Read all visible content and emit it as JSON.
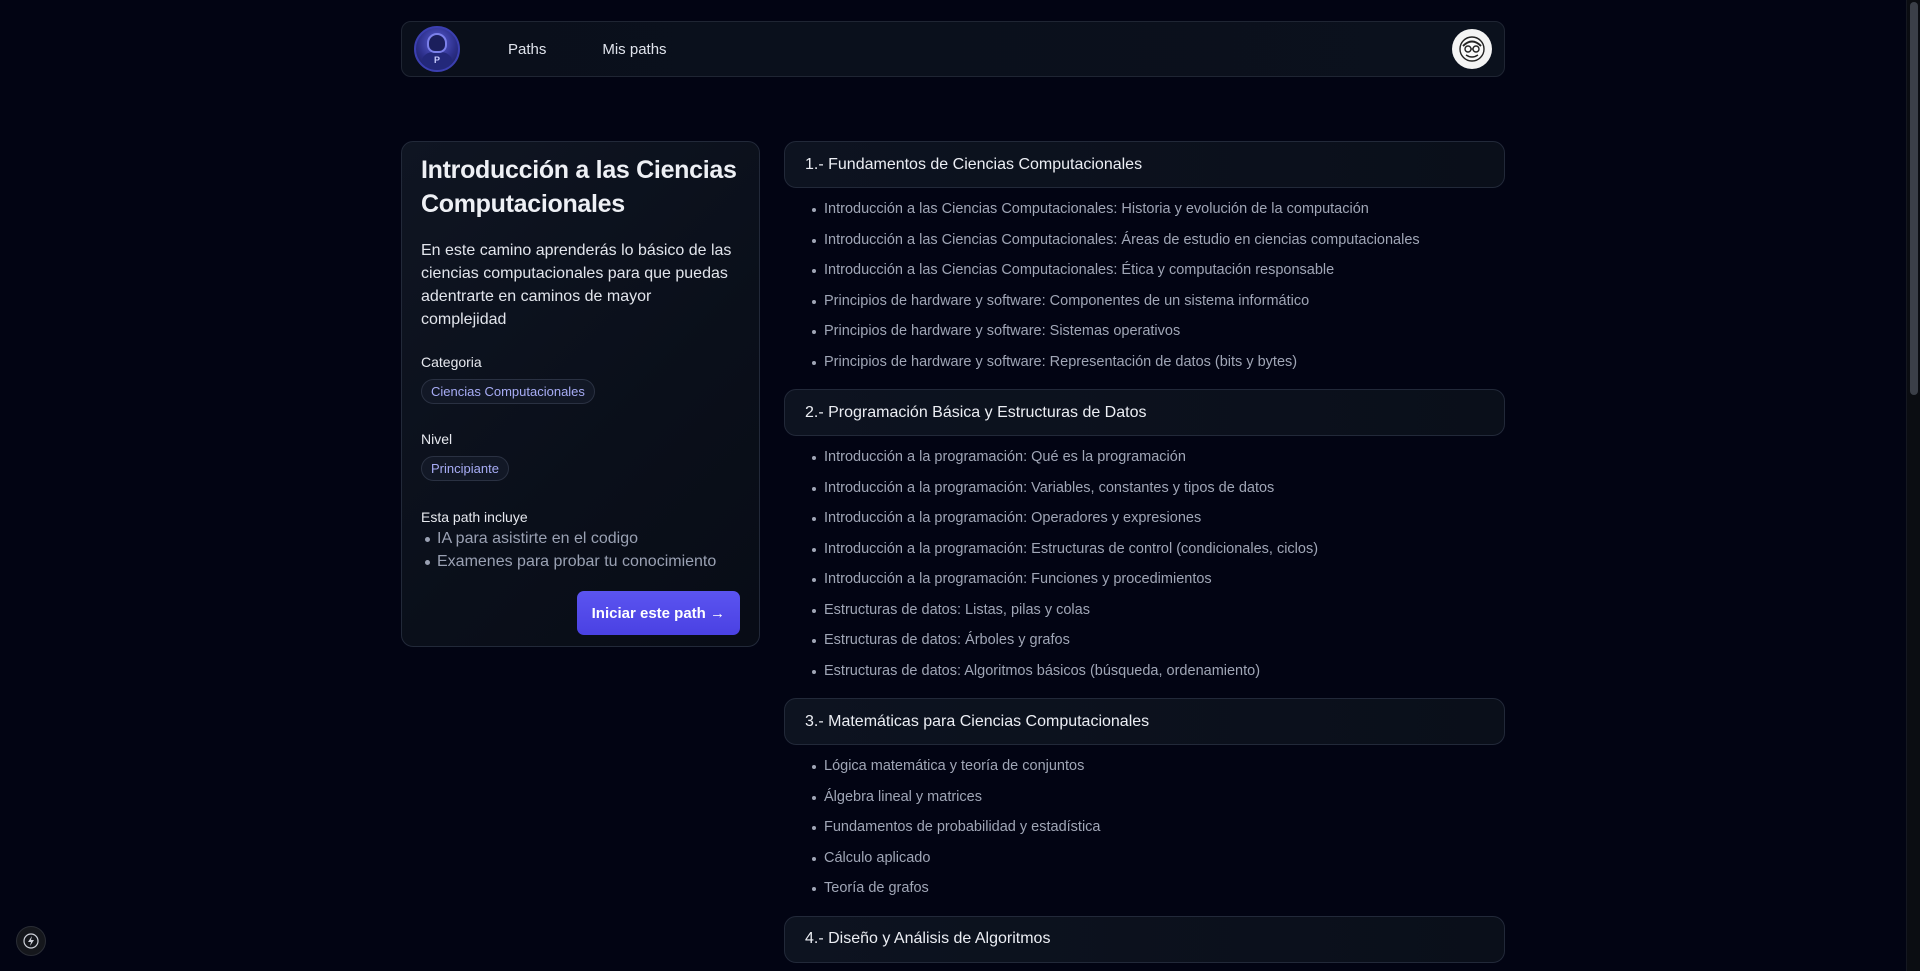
{
  "nav": {
    "logo_letter": "P",
    "links": [
      "Paths",
      "Mis paths"
    ]
  },
  "path": {
    "title": "Introducción a las Ciencias Computacionales",
    "description": "En este camino aprenderás lo básico de las ciencias computacionales para que puedas adentrarte en caminos de mayor complejidad",
    "category_label": "Categoria",
    "category": "Ciencias Computacionales",
    "level_label": "Nivel",
    "level": "Principiante",
    "includes_label": "Esta path incluye",
    "includes": [
      "IA para asistirte en el codigo",
      "Examenes para probar tu conocimiento"
    ],
    "start_button": "Iniciar este path →"
  },
  "modules": [
    {
      "title": "1.- Fundamentos de Ciencias Computacionales",
      "topics": [
        "Introducción a las Ciencias Computacionales: Historia y evolución de la computación",
        "Introducción a las Ciencias Computacionales: Áreas de estudio en ciencias computacionales",
        "Introducción a las Ciencias Computacionales: Ética y computación responsable",
        "Principios de hardware y software: Componentes de un sistema informático",
        "Principios de hardware y software: Sistemas operativos",
        "Principios de hardware y software: Representación de datos (bits y bytes)"
      ]
    },
    {
      "title": "2.- Programación Básica y Estructuras de Datos",
      "topics": [
        "Introducción a la programación: Qué es la programación",
        "Introducción a la programación: Variables, constantes y tipos de datos",
        "Introducción a la programación: Operadores y expresiones",
        "Introducción a la programación: Estructuras de control (condicionales, ciclos)",
        "Introducción a la programación: Funciones y procedimientos",
        "Estructuras de datos: Listas, pilas y colas",
        "Estructuras de datos: Árboles y grafos",
        "Estructuras de datos: Algoritmos básicos (búsqueda, ordenamiento)"
      ]
    },
    {
      "title": "3.- Matemáticas para Ciencias Computacionales",
      "topics": [
        "Lógica matemática y teoría de conjuntos",
        "Álgebra lineal y matrices",
        "Fundamentos de probabilidad y estadística",
        "Cálculo aplicado",
        "Teoría de grafos"
      ]
    },
    {
      "title": "4.- Diseño y Análisis de Algoritmos",
      "topics": []
    }
  ],
  "icons": {
    "avatar": "avatar-icon",
    "fab": "lightning-icon"
  },
  "colors": {
    "background": "#020413",
    "accent": "#4f46e5",
    "pill_text": "#a7acf5"
  }
}
